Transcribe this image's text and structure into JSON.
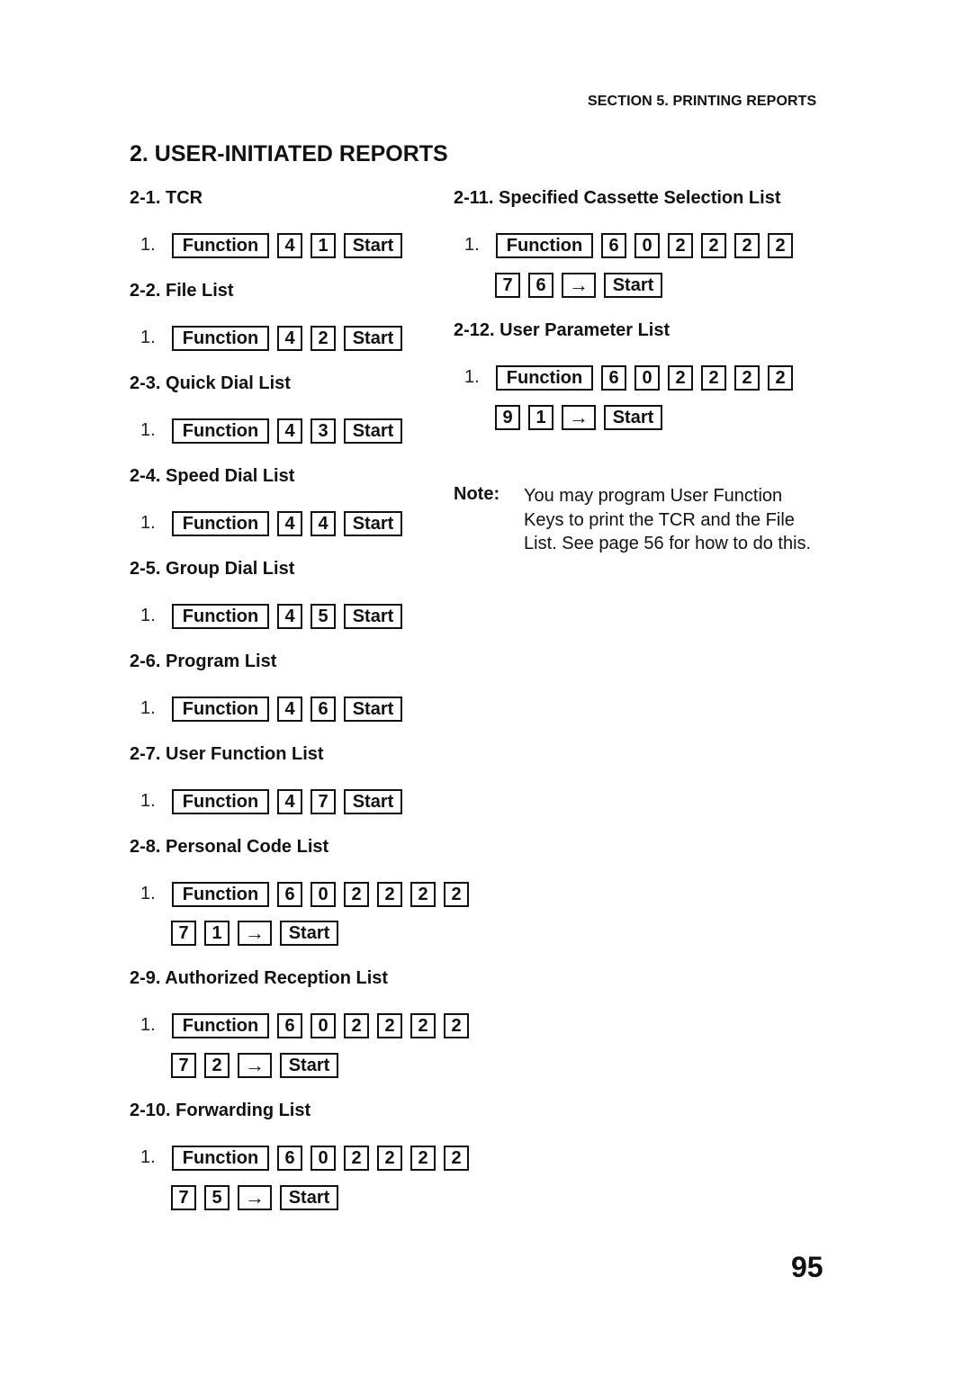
{
  "header": "SECTION 5. PRINTING REPORTS",
  "title": "2. USER-INITIATED REPORTS",
  "sections": [
    {
      "heading": "2-1. TCR",
      "step": "1.",
      "row1": [
        "Function",
        "4",
        "1",
        "Start"
      ],
      "row2": []
    },
    {
      "heading": "2-2. File List",
      "step": "1.",
      "row1": [
        "Function",
        "4",
        "2",
        "Start"
      ],
      "row2": []
    },
    {
      "heading": "2-3. Quick Dial List",
      "step": "1.",
      "row1": [
        "Function",
        "4",
        "3",
        "Start"
      ],
      "row2": []
    },
    {
      "heading": "2-4. Speed Dial List",
      "step": "1.",
      "row1": [
        "Function",
        "4",
        "4",
        "Start"
      ],
      "row2": []
    },
    {
      "heading": "2-5. Group Dial List",
      "step": "1.",
      "row1": [
        "Function",
        "4",
        "5",
        "Start"
      ],
      "row2": []
    },
    {
      "heading": "2-6. Program List",
      "step": "1.",
      "row1": [
        "Function",
        "4",
        "6",
        "Start"
      ],
      "row2": []
    },
    {
      "heading": "2-7. User Function List",
      "step": "1.",
      "row1": [
        "Function",
        "4",
        "7",
        "Start"
      ],
      "row2": []
    },
    {
      "heading": "2-8. Personal Code List",
      "step": "1.",
      "row1": [
        "Function",
        "6",
        "0",
        "2",
        "2",
        "2",
        "2"
      ],
      "row2": [
        "7",
        "1",
        "→",
        "Start"
      ]
    },
    {
      "heading": "2-9. Authorized Reception List",
      "step": "1.",
      "row1": [
        "Function",
        "6",
        "0",
        "2",
        "2",
        "2",
        "2"
      ],
      "row2": [
        "7",
        "2",
        "→",
        "Start"
      ]
    },
    {
      "heading": "2-10. Forwarding List",
      "step": "1.",
      "row1": [
        "Function",
        "6",
        "0",
        "2",
        "2",
        "2",
        "2"
      ],
      "row2": [
        "7",
        "5",
        "→",
        "Start"
      ]
    },
    {
      "heading": "2-11. Specified Cassette Selection List",
      "step": "1.",
      "row1": [
        "Function",
        "6",
        "0",
        "2",
        "2",
        "2",
        "2"
      ],
      "row2": [
        "7",
        "6",
        "→",
        "Start"
      ]
    },
    {
      "heading": "2-12. User Parameter List",
      "step": "1.",
      "row1": [
        "Function",
        "6",
        "0",
        "2",
        "2",
        "2",
        "2"
      ],
      "row2": [
        "9",
        "1",
        "→",
        "Start"
      ]
    }
  ],
  "note": {
    "label": "Note:",
    "lines": [
      "You may program User Function",
      "Keys to print the TCR and the File",
      "List. See page  56 for how to do this."
    ]
  },
  "page_number": "95"
}
